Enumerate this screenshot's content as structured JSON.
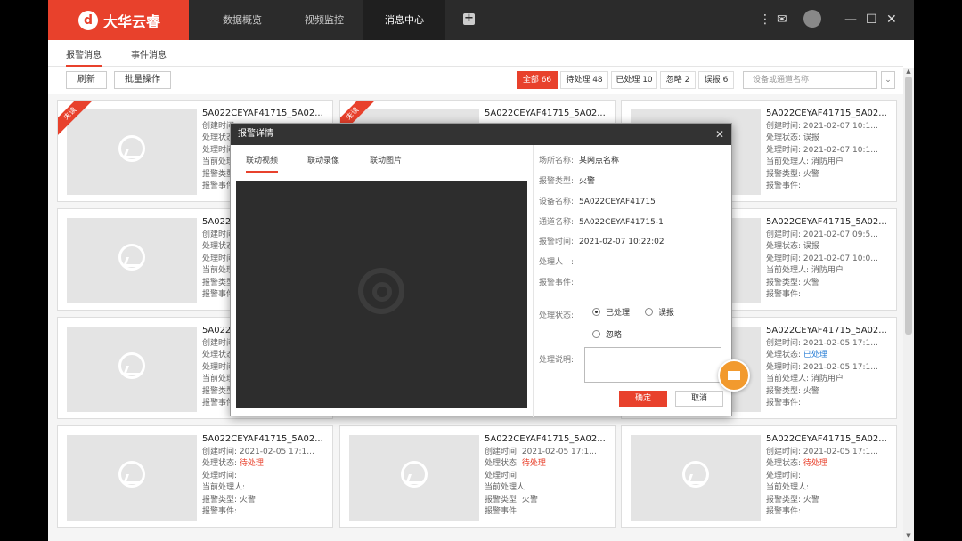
{
  "app": {
    "logo_text": "大华云睿"
  },
  "nav": {
    "tabs": [
      "数据概览",
      "视频监控",
      "消息中心"
    ],
    "active": 2
  },
  "subtabs": [
    "报警消息",
    "事件消息"
  ],
  "toolbar": {
    "refresh": "刷新",
    "batch": "批量操作"
  },
  "filters": [
    "全部 66",
    "待处理 48",
    "已处理 10",
    "忽略 2",
    "误报 6"
  ],
  "search": {
    "placeholder": "设备或通道名称"
  },
  "cards": [
    {
      "title": "5A022CEYAF41715_5A02...",
      "created": "创建时间:",
      "status_label": "处理状态:",
      "status": "",
      "handled": "处理时间:",
      "handler": "当前处理人:",
      "alarm_type": "报警类型:",
      "alarm_event": "报警事件:",
      "unread": "未读"
    },
    {
      "title": "5A022CEYAF41715_5A02...",
      "created": "",
      "status_label": "",
      "status": "",
      "handled": "",
      "handler": "",
      "alarm_type": "",
      "alarm_event": "",
      "unread": "未读"
    },
    {
      "title": "5A022CEYAF41715_5A02...",
      "created": "创建时间: 2021-02-07 10:1...",
      "status_label": "处理状态:",
      "status": "误报",
      "handled": "处理时间: 2021-02-07 10:1...",
      "handler": "当前处理人: 消防用户",
      "alarm_type": "报警类型: 火警",
      "alarm_event": "报警事件:"
    },
    {
      "title": "5A022CEYAF41715_5A02...",
      "created": "创建时间:",
      "status_label": "处理状态:",
      "status": "",
      "handled": "处理时间:",
      "handler": "当前处理人:",
      "alarm_type": "报警类型:",
      "alarm_event": "报警事件:"
    },
    {
      "title": "5A022CEYAF41715_5A02...",
      "created": "创建时间: 2021-02-07 09:5...",
      "status_label": "处理状态:",
      "status": "误报",
      "handled": "处理时间: 2021-02-07 10:0...",
      "handler": "当前处理人: 消防用户",
      "alarm_type": "报警类型: 火警",
      "alarm_event": "报警事件:"
    },
    {
      "title": "5A022CEYAF41715_5A02...",
      "created": "创建时间:",
      "status_label": "处理状态:",
      "status": "",
      "handled": "处理时间:",
      "handler": "当前处理人:",
      "alarm_type": "报警类型:",
      "alarm_event": "报警事件:"
    },
    {
      "title": "5A022CEYAF41715_5A02...",
      "created": "创建时间: 2021-02-05 17:1...",
      "status_label": "处理状态:",
      "status": "已处理",
      "handled": "处理时间: 2021-02-05 17:1...",
      "handler": "当前处理人: 消防用户",
      "alarm_type": "报警类型: 火警",
      "alarm_event": "报警事件:"
    },
    {
      "title": "5A022CEYAF41715_5A02...",
      "created": "创建时间: 2021-02-05 17:1...",
      "status_label": "处理状态:",
      "status": "待处理",
      "handled": "处理时间:",
      "handler": "当前处理人:",
      "alarm_type": "报警类型: 火警",
      "alarm_event": "报警事件:"
    },
    {
      "title": "5A022CEYAF41715_5A02...",
      "created": "创建时间: 2021-02-05 17:1...",
      "status_label": "处理状态:",
      "status": "待处理",
      "handled": "处理时间:",
      "handler": "当前处理人:",
      "alarm_type": "报警类型: 火警",
      "alarm_event": "报警事件:"
    },
    {
      "title": "5A022CEYAF41715_5A02...",
      "created": "创建时间: 2021-02-05 17:1...",
      "status_label": "处理状态:",
      "status": "待处理",
      "handled": "处理时间:",
      "handler": "当前处理人:",
      "alarm_type": "报警类型: 火警",
      "alarm_event": "报警事件:"
    }
  ],
  "modal": {
    "title": "报警详情",
    "tabs": [
      "联动视频",
      "联动录像",
      "联动图片"
    ],
    "fields": [
      {
        "label": "场所名称:",
        "value": "某网点名称"
      },
      {
        "label": "报警类型:",
        "value": "火警"
      },
      {
        "label": "设备名称:",
        "value": "5A022CEYAF41715"
      },
      {
        "label": "通道名称:",
        "value": "5A022CEYAF41715-1"
      },
      {
        "label": "报警时间:",
        "value": "2021-02-07 10:22:02"
      },
      {
        "label": "处理人　:",
        "value": ""
      },
      {
        "label": "报警事件:",
        "value": ""
      }
    ],
    "status_label": "处理状态:",
    "status_options": [
      "已处理",
      "误报",
      "忽略"
    ],
    "status_selected": "已处理",
    "note_label": "处理说明:",
    "ok": "确定",
    "cancel": "取消"
  },
  "colors": {
    "accent": "#e8412c",
    "titlebar": "#2b2b2b",
    "done": "#2a7fd6",
    "fab": "#f29a2e"
  }
}
